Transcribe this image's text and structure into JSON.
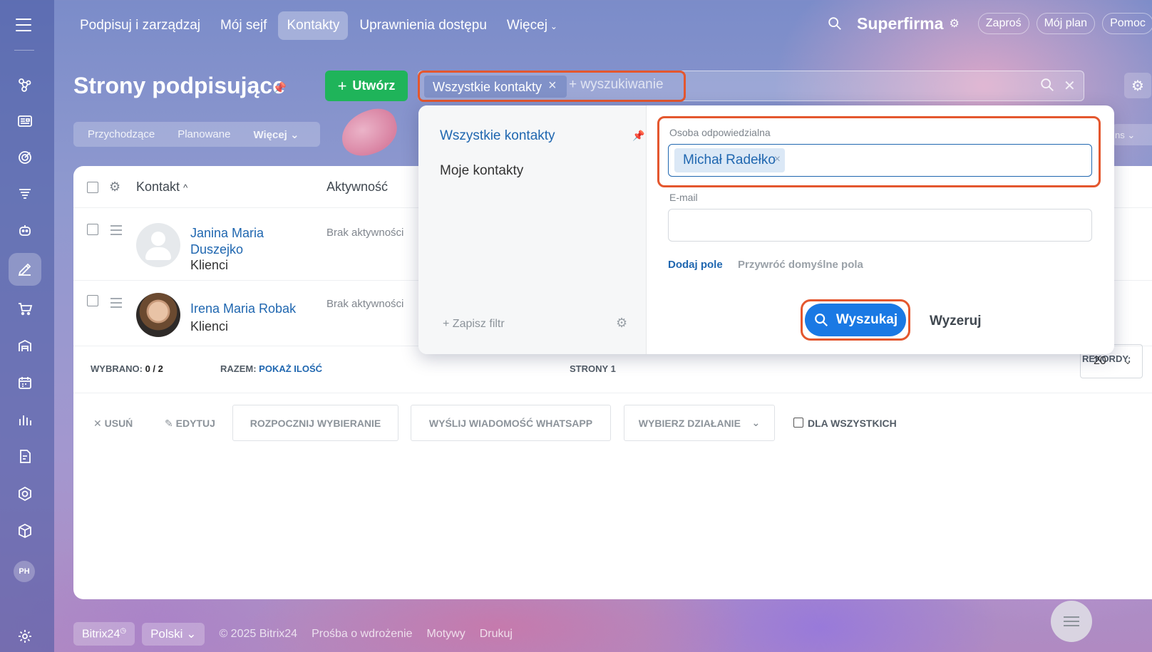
{
  "topnav": {
    "tabs": [
      "Podpisuj i zarządzaj",
      "Mój sejf",
      "Kontakty",
      "Uprawnienia dostępu",
      "Więcej"
    ],
    "active_index": 2
  },
  "header_right": {
    "brand": "Superfirma",
    "pills": [
      "Zaproś",
      "Mój plan",
      "Pomoc"
    ]
  },
  "page": {
    "title": "Strony podpisujące",
    "create_label": "Utwórz"
  },
  "filter": {
    "active_preset": "Wszystkie kontakty",
    "search_placeholder": "+ wyszukiwanie"
  },
  "subtabs": [
    "Przychodzące",
    "Planowane",
    "Więcej"
  ],
  "edge_text": "ns",
  "table": {
    "columns": [
      "Kontakt",
      "Aktywność"
    ],
    "rows": [
      {
        "name_line1": "Janina Maria",
        "name_line2": "Duszejko",
        "group": "Klienci",
        "activity": "Brak aktywności"
      },
      {
        "name_line1": "Irena Maria Robak",
        "name_line2": "",
        "group": "Klienci",
        "activity": "Brak aktywności"
      }
    ]
  },
  "summary": {
    "selected_label": "WYBRANO:",
    "selected_value": "0 / 2",
    "total_label": "RAZEM:",
    "total_link": "POKAŻ ILOŚĆ",
    "pages_label": "STRONY",
    "pages_value": "1",
    "records_label": "REKORDY:",
    "records_value": "20"
  },
  "actions": {
    "delete": "USUŃ",
    "edit": "EDYTUJ",
    "start_dialing": "ROZPOCZNIJ WYBIERANIE",
    "send_whatsapp": "WYŚLIJ WIADOMOŚĆ WHATSAPP",
    "choose_action": "WYBIERZ DZIAŁANIE",
    "for_all": "DLA WSZYSTKICH"
  },
  "popup": {
    "presets": [
      "Wszystkie kontakty",
      "Moje kontakty"
    ],
    "save_filter": "Zapisz filtr",
    "responsible_label": "Osoba odpowiedzialna",
    "responsible_value": "Michał Radełko",
    "email_label": "E-mail",
    "add_field": "Dodaj pole",
    "restore_fields": "Przywróć domyślne pola",
    "search_button": "Wyszukaj",
    "reset_button": "Wyzeruj"
  },
  "footer": {
    "brand": "Bitrix24",
    "language": "Polski",
    "copyright": "© 2025 Bitrix24",
    "links": [
      "Prośba o wdrożenie",
      "Motywy",
      "Drukuj"
    ]
  },
  "rail": {
    "user_initials": "PH"
  },
  "colors": {
    "accent_blue": "#1a79e4",
    "create_green": "#1fb45a",
    "highlight_orange": "#e4572e",
    "link_blue": "#2067b0"
  },
  "icons": [
    "menu-icon",
    "nodes-icon",
    "news-icon",
    "target-icon",
    "funnel-icon",
    "robot-icon",
    "sign-icon",
    "cart-icon",
    "warehouse-icon",
    "calendar-icon",
    "chart-icon",
    "document-icon",
    "hexagon-icon",
    "box-icon",
    "settings-icon"
  ]
}
